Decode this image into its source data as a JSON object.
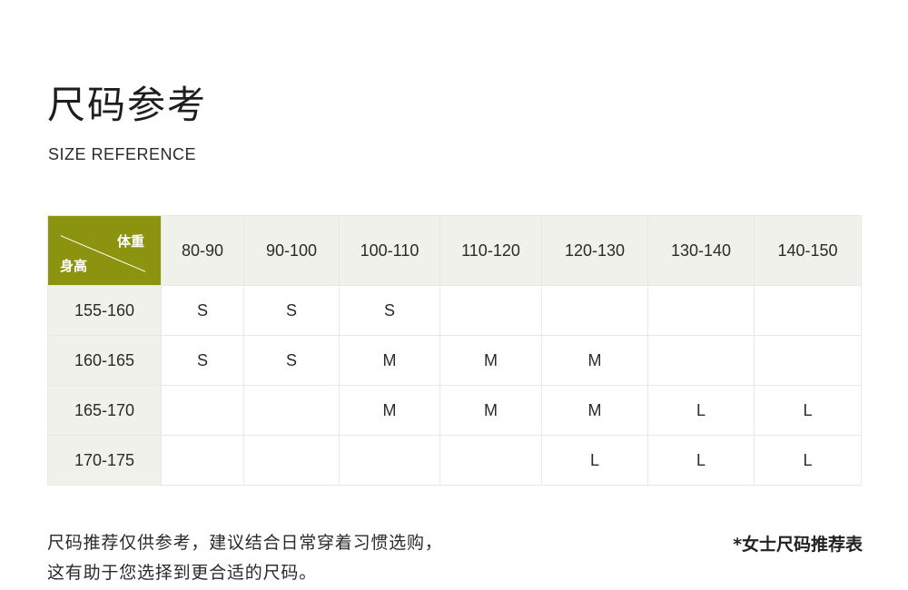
{
  "header": {
    "title": "尺码参考",
    "subtitle": "SIZE REFERENCE"
  },
  "table": {
    "corner_weight_label": "体重",
    "corner_height_label": "身高",
    "accent_color": "#8c930e",
    "header_bg": "#f1f1ec",
    "weights": [
      "80-90",
      "90-100",
      "100-110",
      "110-120",
      "120-130",
      "130-140",
      "140-150"
    ],
    "rows": [
      {
        "height": "155-160",
        "sizes": [
          "S",
          "S",
          "S",
          "",
          "",
          "",
          ""
        ]
      },
      {
        "height": "160-165",
        "sizes": [
          "S",
          "S",
          "M",
          "M",
          "M",
          "",
          ""
        ]
      },
      {
        "height": "165-170",
        "sizes": [
          "",
          "",
          "M",
          "M",
          "M",
          "L",
          "L"
        ]
      },
      {
        "height": "170-175",
        "sizes": [
          "",
          "",
          "",
          "",
          "L",
          "L",
          "L"
        ]
      }
    ]
  },
  "footer": {
    "note_line1": "尺码推荐仅供参考，建议结合日常穿着习惯选购，",
    "note_line2": "这有助于您选择到更合适的尺码。",
    "tag": "*女士尺码推荐表"
  }
}
